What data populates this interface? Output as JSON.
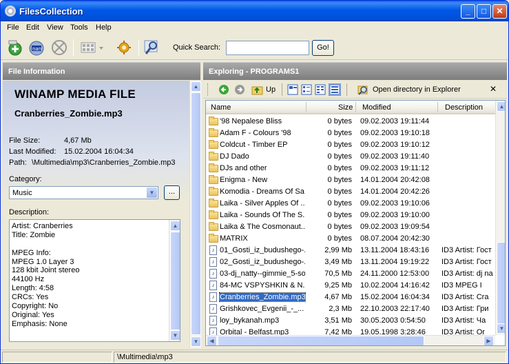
{
  "window": {
    "title": "FilesCollection",
    "buttons": {
      "min": "_",
      "max": "□",
      "close": "✕"
    }
  },
  "menu": [
    "File",
    "Edit",
    "View",
    "Tools",
    "Help"
  ],
  "toolbar": {
    "tools": [
      {
        "name": "add-icon"
      },
      {
        "name": "scan-icon"
      },
      {
        "name": "stop-icon"
      },
      {
        "name": "view-mode-icon"
      },
      {
        "name": "settings-icon"
      },
      {
        "name": "search-icon"
      }
    ],
    "quick_search_label": "Quick Search:",
    "quick_search_value": "",
    "go_label": "Go!"
  },
  "left": {
    "header": "File Information",
    "file_type": "WINAMP MEDIA FILE",
    "file_name": "Cranberries_Zombie.mp3",
    "file_size_label": "File Size:",
    "file_size": "4,67 Mb",
    "modified_label": "Last Modified:",
    "modified": "15.02.2004 16:04:34",
    "path_label": "Path:",
    "path": "\\Multimedia\\mp3\\Cranberries_Zombie.mp3",
    "category_label": "Category:",
    "category_value": "Music",
    "category_btn": "...",
    "description_label": "Description:",
    "description_lines": [
      "Artist: Cranberries",
      "Title: Zombie",
      "",
      "MPEG Info:",
      "MPEG 1.0 Layer 3",
      "128 kbit Joint stereo",
      "44100 Hz",
      "Length: 4:58",
      "CRCs: Yes",
      "Copyright: No",
      "Original: Yes",
      "Emphasis: None"
    ]
  },
  "right": {
    "header": "Exploring - PROGRAMS1",
    "up_label": "Up",
    "open_dir_label": "Open directory in Explorer",
    "close_label": "✕",
    "columns": [
      "Name",
      "Size",
      "Modified",
      "Description"
    ],
    "rows": [
      {
        "type": "folder",
        "name": "'98 Nepalese Bliss",
        "size": "0 bytes",
        "modified": "09.02.2003 19:11:44",
        "desc": ""
      },
      {
        "type": "folder",
        "name": "Adam F - Colours '98",
        "size": "0 bytes",
        "modified": "09.02.2003 19:10:18",
        "desc": ""
      },
      {
        "type": "folder",
        "name": "Coldcut - Timber EP",
        "size": "0 bytes",
        "modified": "09.02.2003 19:10:12",
        "desc": ""
      },
      {
        "type": "folder",
        "name": "DJ Dado",
        "size": "0 bytes",
        "modified": "09.02.2003 19:11:40",
        "desc": ""
      },
      {
        "type": "folder",
        "name": "DJs and other",
        "size": "0 bytes",
        "modified": "09.02.2003 19:11:12",
        "desc": ""
      },
      {
        "type": "folder",
        "name": "Enigma - New",
        "size": "0 bytes",
        "modified": "14.01.2004 20:42:08",
        "desc": ""
      },
      {
        "type": "folder",
        "name": "Komodia - Dreams Of Sa...",
        "size": "0 bytes",
        "modified": "14.01.2004 20:42:26",
        "desc": ""
      },
      {
        "type": "folder",
        "name": "Laika - Silver Apples Of ...",
        "size": "0 bytes",
        "modified": "09.02.2003 19:10:06",
        "desc": ""
      },
      {
        "type": "folder",
        "name": "Laika - Sounds Of The S...",
        "size": "0 bytes",
        "modified": "09.02.2003 19:10:00",
        "desc": ""
      },
      {
        "type": "folder",
        "name": "Laika & The Cosmonaut...",
        "size": "0 bytes",
        "modified": "09.02.2003 19:09:54",
        "desc": ""
      },
      {
        "type": "folder",
        "name": "MATRIX",
        "size": "0 bytes",
        "modified": "08.07.2004 20:42:30",
        "desc": ""
      },
      {
        "type": "mp3",
        "name": "01_Gosti_iz_budushego-...",
        "size": "2,99 Mb",
        "modified": "13.11.2004 18:43:16",
        "desc": "ID3 Artist: Гост"
      },
      {
        "type": "mp3",
        "name": "02_Gosti_iz_budushego-...",
        "size": "3,49 Mb",
        "modified": "13.11.2004 19:19:22",
        "desc": "ID3 Artist: Гост"
      },
      {
        "type": "mp3",
        "name": "03-dj_natty--gimmie_5-so...",
        "size": "70,5 Mb",
        "modified": "24.11.2000 12:53:00",
        "desc": "ID3 Artist: dj na"
      },
      {
        "type": "mp3",
        "name": "84-MC VSPYSHKIN & N...",
        "size": "9,25 Mb",
        "modified": "10.02.2004 14:16:42",
        "desc": "ID3     MPEG I"
      },
      {
        "type": "mp3",
        "name": "Cranberries_Zombie.mp3",
        "size": "4,67 Mb",
        "modified": "15.02.2004 16:04:34",
        "desc": "ID3  Artist: Cra",
        "selected": true
      },
      {
        "type": "mp3",
        "name": "Grishkovec_Evgenii_-_...",
        "size": "2,3 Mb",
        "modified": "22.10.2003 22:17:40",
        "desc": "ID3  Artist: Гри"
      },
      {
        "type": "mp3",
        "name": "loy_bykanah.mp3",
        "size": "3,51 Mb",
        "modified": "30.05.2003 0:54:50",
        "desc": "ID3  Artist: Ча"
      },
      {
        "type": "mp3",
        "name": "Orbital - Belfast.mp3",
        "size": "7,42 Mb",
        "modified": "19.05.1998 3:28:46",
        "desc": "ID3  Artist: Or"
      }
    ]
  },
  "status": {
    "path": "\\Multimedia\\mp3"
  }
}
